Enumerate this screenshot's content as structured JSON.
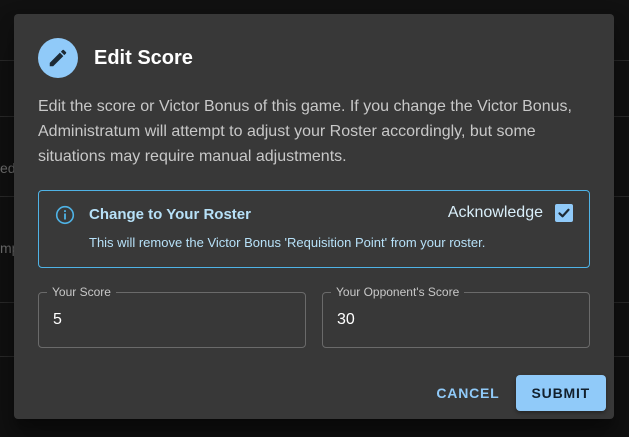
{
  "background": {
    "fragments": [
      "ed",
      "mp"
    ]
  },
  "dialog": {
    "title": "Edit Score",
    "title_icon": "pencil-icon",
    "description": "Edit the score or Victor Bonus of this game. If you change the Victor Bonus, Administratum will attempt to adjust your Roster accordingly, but some situations may require manual adjustments."
  },
  "alert": {
    "icon": "info-icon",
    "title": "Change to Your Roster",
    "message": "This will remove the Victor Bonus 'Requisition Point' from your roster.",
    "acknowledge_label": "Acknowledge",
    "acknowledged": true
  },
  "fields": {
    "your_score": {
      "label": "Your Score",
      "value": "5"
    },
    "opponent_score": {
      "label": "Your Opponent's Score",
      "value": "30"
    }
  },
  "actions": {
    "cancel": "CANCEL",
    "submit": "SUBMIT"
  },
  "colors": {
    "accent": "#90caf9",
    "alert_border": "#4fb3e6",
    "surface": "#383838"
  }
}
